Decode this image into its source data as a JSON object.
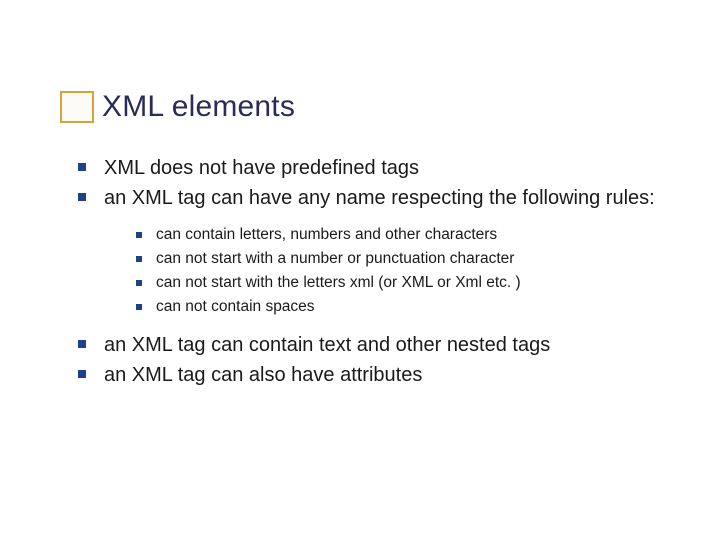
{
  "title": "XML elements",
  "bullets": {
    "b1": "XML does not have predefined tags",
    "b2": "an XML tag can have any name respecting the following rules:",
    "sub": {
      "s1": "can contain letters, numbers and other characters",
      "s2": "can not start with a number or punctuation character",
      "s3": "can not start with the letters xml (or XML or Xml etc. )",
      "s4": "can not contain spaces"
    },
    "b3": "an XML tag can contain text and other nested tags",
    "b4": "an XML tag can also have attributes"
  }
}
